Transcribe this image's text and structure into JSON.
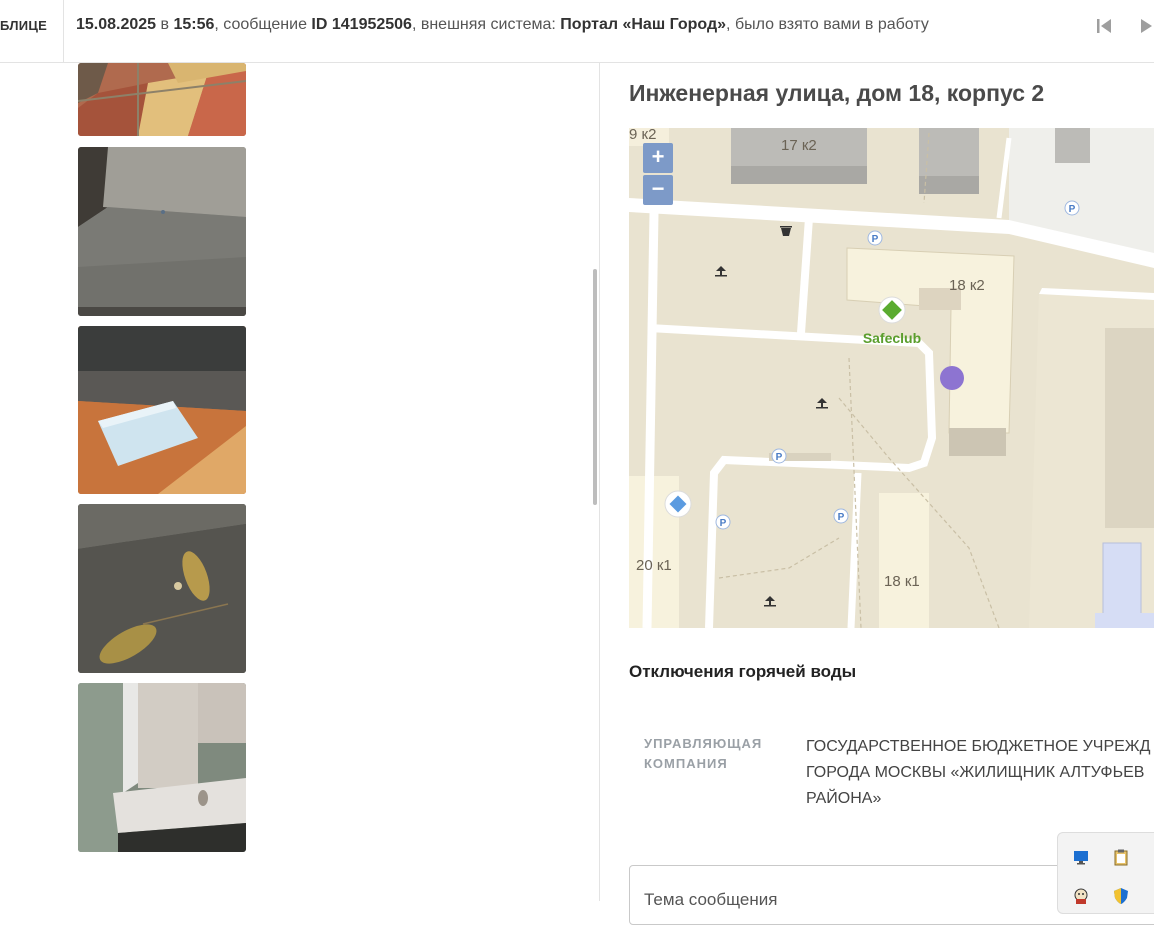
{
  "topbar": {
    "left_label": "БЛИЦЕ",
    "date": "15.08.2025",
    "in": " в ",
    "time": "15:56",
    "msg_text": ", сообщение ",
    "msg_id": "ID 141952506",
    "ext_text": ", внешняя система: ",
    "system": "Портал «Наш Город»",
    "tail": ", было взято вами в работу"
  },
  "photos": [
    {
      "icon": "tile-floor-photo"
    },
    {
      "icon": "concrete-step-photo"
    },
    {
      "icon": "mask-on-floor-photo"
    },
    {
      "icon": "leaves-on-asphalt-photo"
    },
    {
      "icon": "window-sill-photo"
    }
  ],
  "address": "Инженерная улица, дом 18, корпус 2",
  "map": {
    "zoom_in": "+",
    "zoom_out": "−",
    "labels": {
      "b_9k2": "9 к2",
      "b_17k2": "17 к2",
      "b_18k2": "18 к2",
      "b_20k1": "20 к1",
      "b_18k1": "18 к1",
      "poi": "Safeclub",
      "parking": "P"
    }
  },
  "section_title": "Отключения горячей воды",
  "management": {
    "label_line1": "УПРАВЛЯЮЩАЯ",
    "label_line2": "КОМПАНИЯ",
    "value_line1": "ГОСУДАРСТВЕННОЕ БЮДЖЕТНОЕ УЧРЕЖД",
    "value_line2": "ГОРОДА МОСКВЫ «ЖИЛИЩНИК АЛТУФЬЕВ",
    "value_line3": "РАЙОНА»"
  },
  "subject_label": "Тема сообщения",
  "colors": {
    "accent": "#7d9ac8",
    "marker": "#8d74d1",
    "poi_green": "#5a9e2d",
    "map_bg": "#e9e3d0"
  }
}
